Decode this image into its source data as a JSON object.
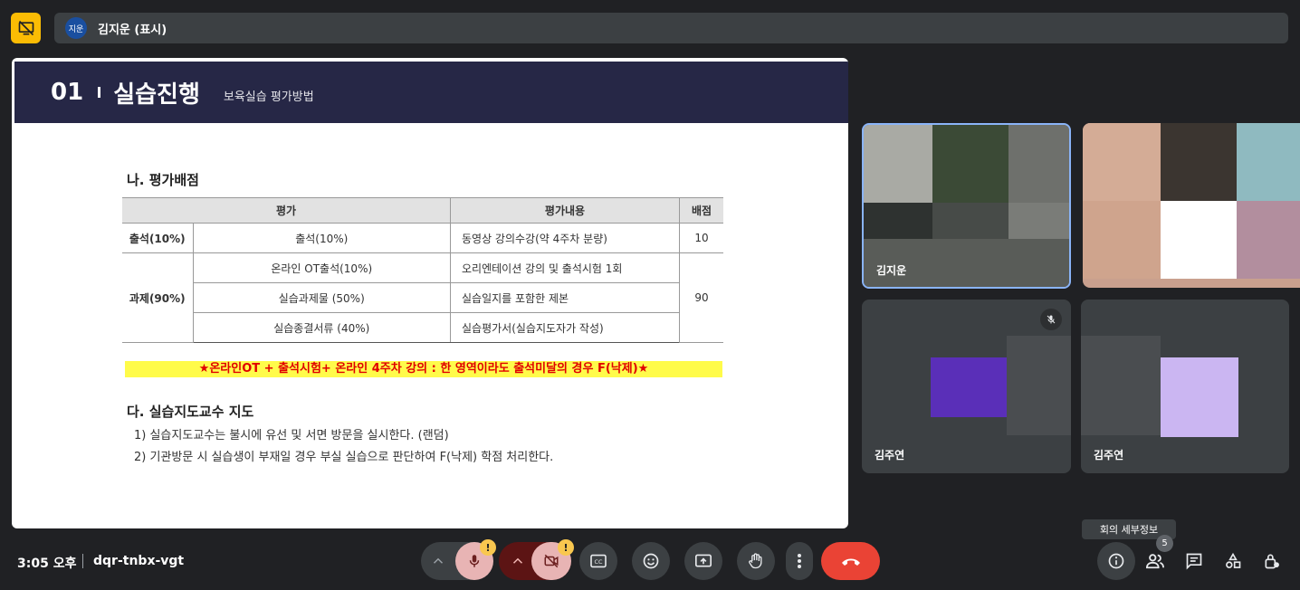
{
  "presenter": {
    "avatar_text": "지운",
    "name": "김지운 (표시)"
  },
  "slide": {
    "number": "01",
    "title": "실습진행",
    "subtitle": "보육실습 평가방법",
    "section_title": "나. 평가배점",
    "table": {
      "headers": [
        "평가",
        "평가내용",
        "배점"
      ],
      "rows": [
        {
          "category": "출석(10%)",
          "item": "출석(10%)",
          "content": "동영상 강의수강(약 4주차 분량)",
          "score": "10"
        },
        {
          "category": "과제(90%)",
          "item": "온라인 OT출석(10%)",
          "content": "오리엔테이션 강의 및 출석시험 1회",
          "score": "90"
        },
        {
          "item": "실습과제물 (50%)",
          "content": "실습일지를 포함한 제본"
        },
        {
          "item": "실습종결서류 (40%)",
          "content": "실습평가서(실습지도자가 작성)"
        }
      ]
    },
    "warning": "★온라인OT + 출석시험+ 온라인 4주차 강의 : 한 영역이라도 출석미달의 경우 F(낙제)★",
    "section2_title": "다. 실습지도교수 지도",
    "lines": [
      "1) 실습지도교수는 불시에 유선 및 서면 방문을 실시한다. (랜덤)",
      "2) 기관방문 시 실습생이 부재일 경우 부실 실습으로 판단하여 F(낙제) 학점 처리한다."
    ]
  },
  "participants": [
    {
      "name": "김지운"
    },
    {
      "name": "김주연"
    },
    {
      "name": "김주연"
    }
  ],
  "meeting": {
    "time": "3:05 오후",
    "code": "dqr-tnbx-vgt"
  },
  "controls": {
    "alert_badge": "!",
    "participant_count": "5",
    "details_tooltip": "회의 세부정보"
  },
  "colors": {
    "accent_yellow": "#fbbc04",
    "hangup_red": "#ea4335",
    "slide_header": "#262746",
    "warning_text": "#e00000",
    "warning_bg": "#fffb4a"
  }
}
